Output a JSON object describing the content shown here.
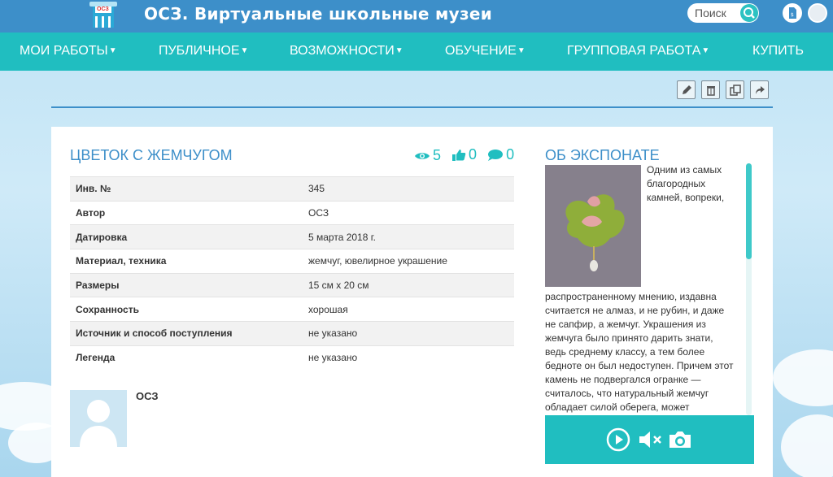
{
  "header": {
    "site_title": "ОСЗ. Виртуальные школьные музеи",
    "logo_text": "ОСЗ",
    "search_label": "Поиск"
  },
  "nav": {
    "items": [
      {
        "label": "МОИ РАБОТЫ"
      },
      {
        "label": "ПУБЛИЧНОЕ"
      },
      {
        "label": "ВОЗМОЖНОСТИ"
      },
      {
        "label": "ОБУЧЕНИЕ"
      },
      {
        "label": "ГРУППОВАЯ РАБОТА"
      },
      {
        "label": "КУПИТЬ"
      }
    ]
  },
  "exhibit": {
    "title": "ЦВЕТОК С ЖЕМЧУГОМ",
    "views": "5",
    "likes": "0",
    "comments": "0",
    "properties": [
      {
        "key": "Инв. №",
        "value": "345"
      },
      {
        "key": "Автор",
        "value": "ОСЗ"
      },
      {
        "key": "Датировка",
        "value": "5 марта 2018 г."
      },
      {
        "key": "Материал, техника",
        "value": "жемчуг, ювелирное украшение"
      },
      {
        "key": "Размеры",
        "value": "15 см х 20 см"
      },
      {
        "key": "Сохранность",
        "value": "хорошая"
      },
      {
        "key": "Источник и способ поступления",
        "value": "не указано"
      },
      {
        "key": "Легенда",
        "value": "не указано"
      }
    ],
    "author_name": "ОСЗ"
  },
  "about": {
    "title": "ОБ ЭКСПОНАТЕ",
    "text": "Одним из самых благородных камней, вопреки, распространенному мнению, издавна считается не алмаз, и не рубин, и даже не сапфир, а жемчуг. Украшения из жемчуга было принято дарить знати, ведь среднему классу, а тем более бедноте он был недоступен. Причем этот камень не подвергался огранке — считалось, что натуральный жемчуг обладает силой оберега, может"
  },
  "colors": {
    "header_blue": "#3d8fc9",
    "nav_teal": "#20bec0",
    "accent": "#20bec0"
  }
}
